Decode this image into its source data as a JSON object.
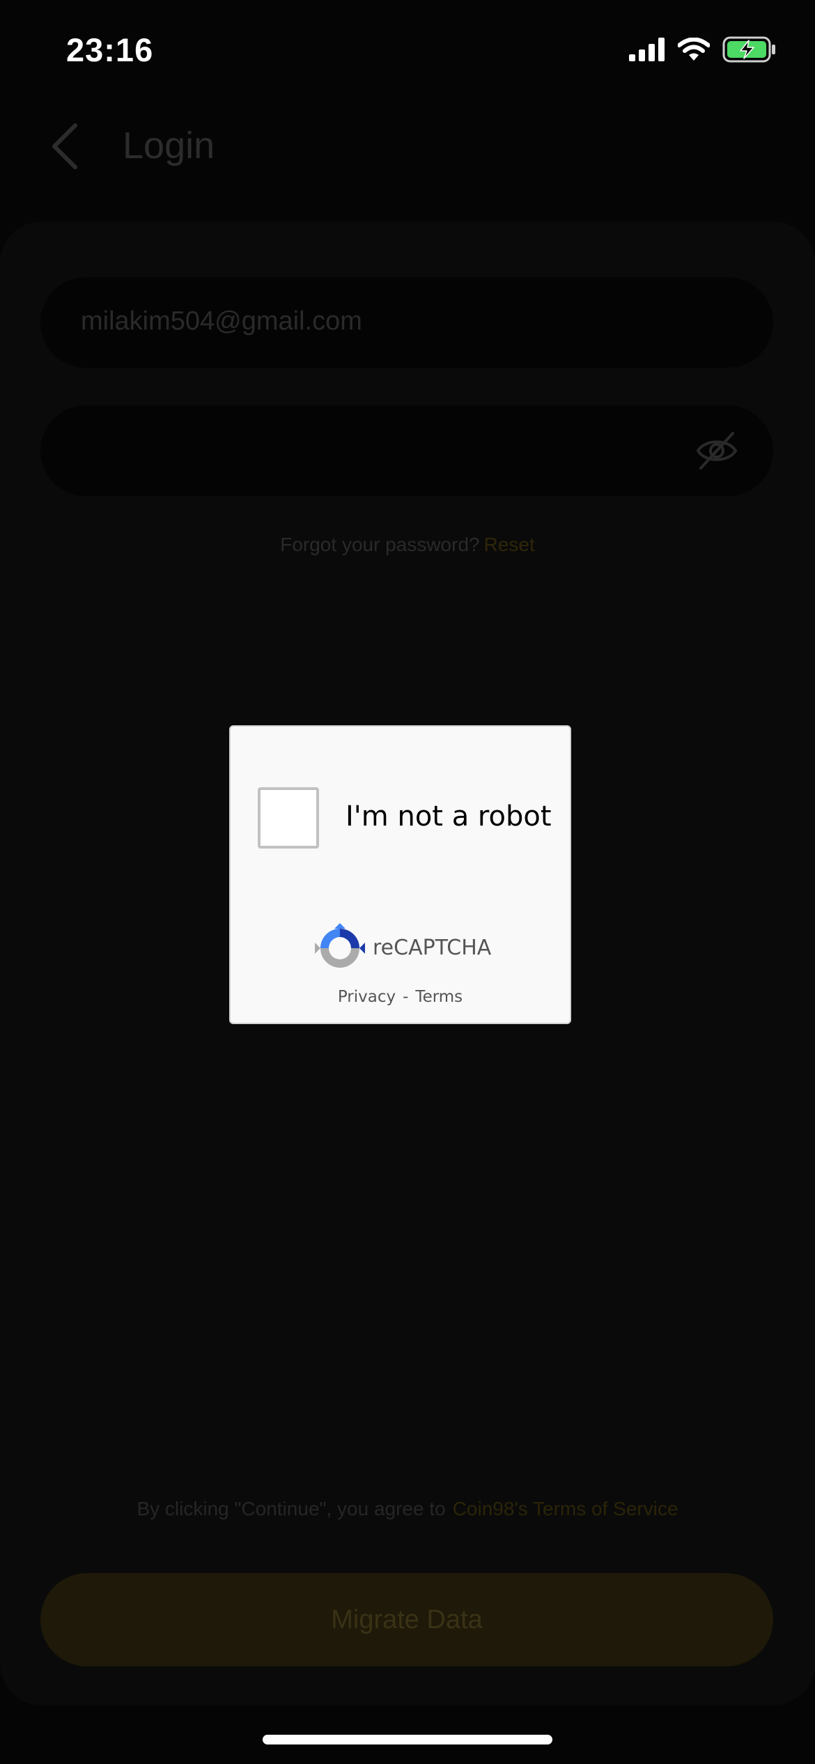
{
  "status_bar": {
    "time": "23:16",
    "icons": [
      "cellular-signal-icon",
      "wifi-icon",
      "battery-charging-icon"
    ],
    "battery_color": "#4cd964"
  },
  "header": {
    "title": "Login",
    "back_icon": "chevron-left-icon"
  },
  "form": {
    "email_value": "milakim504@gmail.com",
    "password_value": "",
    "password_toggle_icon": "eye-slash-icon",
    "forgot_text": "Forgot your password?",
    "reset_label": "Reset"
  },
  "footer": {
    "terms_prefix": "By clicking \"Continue\", you agree to",
    "terms_link": "Coin98's Terms of Service",
    "primary_button": "Migrate Data",
    "accent_color": "#e0b11d"
  },
  "recaptcha": {
    "label": "I'm not a robot",
    "brand": "reCAPTCHA",
    "privacy": "Privacy",
    "separator": "-",
    "terms": "Terms",
    "checked": false
  }
}
